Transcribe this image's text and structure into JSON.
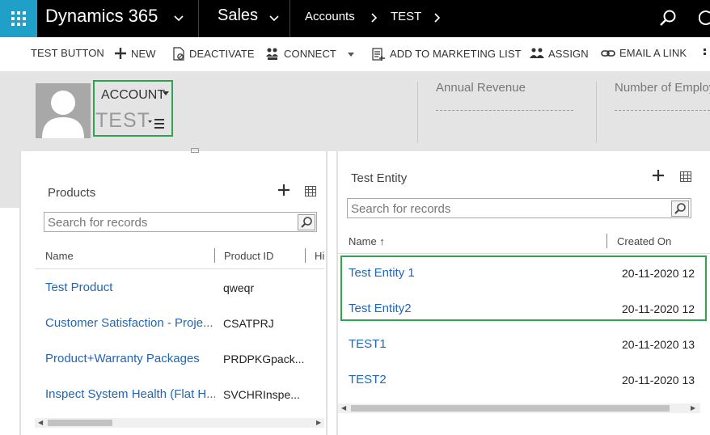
{
  "nav": {
    "app_name": "Dynamics 365",
    "area": "Sales",
    "breadcrumb": [
      "Accounts",
      "TEST"
    ]
  },
  "commands": {
    "test_button": "TEST BUTTON",
    "new": "NEW",
    "deactivate": "DEACTIVATE",
    "connect": "CONNECT",
    "add_to_marketing_list": "ADD TO MARKETING LIST",
    "assign": "ASSIGN",
    "email_a_link": "EMAIL A LINK"
  },
  "record": {
    "entity_type": "ACCOUNT",
    "name": "TEST",
    "header_fields": [
      "Annual Revenue",
      "Number of Employ"
    ]
  },
  "products": {
    "title": "Products",
    "search_placeholder": "Search for records",
    "columns": [
      "Name",
      "Product ID",
      "Hi"
    ],
    "rows": [
      {
        "name": "Test Product",
        "id": "qweqr"
      },
      {
        "name": "Customer Satisfaction - Proje...",
        "id": "CSATPRJ"
      },
      {
        "name": "Product+Warranty Packages",
        "id": "PRDPKGpack..."
      },
      {
        "name": "Inspect System Health (Flat H...",
        "id": "SVCHRInspe..."
      }
    ]
  },
  "test_entity": {
    "title": "Test Entity",
    "search_placeholder": "Search for records",
    "columns": [
      "Name ↑",
      "Created On"
    ],
    "rows": [
      {
        "name": "Test Entity 1",
        "created": "20-11-2020 12"
      },
      {
        "name": "Test Entity2",
        "created": "20-11-2020 12"
      },
      {
        "name": "TEST1",
        "created": "20-11-2020 13"
      },
      {
        "name": "TEST2",
        "created": "20-11-2020 13"
      }
    ]
  },
  "colors": {
    "waffle": "#1fa0c9",
    "highlight": "#2ea44f",
    "link": "#2266b5"
  }
}
